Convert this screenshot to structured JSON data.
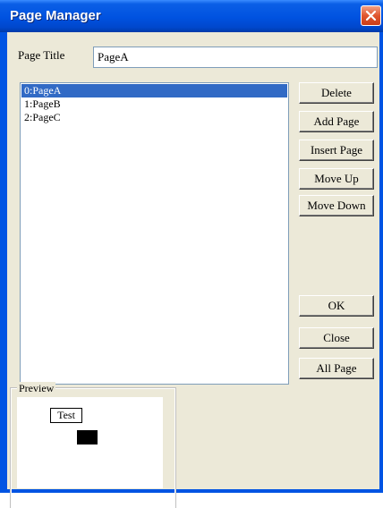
{
  "window": {
    "title": "Page Manager"
  },
  "form": {
    "page_title_label": "Page Title",
    "page_title_value": "PageA"
  },
  "pages": [
    "0:PageA",
    "1:PageB",
    "2:PageC"
  ],
  "selected_index": 0,
  "buttons": {
    "delete": "Delete",
    "add_page": "Add Page",
    "insert_page": "Insert Page",
    "move_up": "Move Up",
    "move_down": "Move Down",
    "ok": "OK",
    "close": "Close",
    "all_page": "All Page"
  },
  "preview": {
    "caption": "Preview",
    "text": "Test"
  },
  "colors": {
    "title_bar": "#0054e3",
    "selection": "#316ac5",
    "dialog_face": "#ece9d8",
    "close_button": "#e0562f"
  },
  "icons": {
    "close": "close-icon"
  }
}
